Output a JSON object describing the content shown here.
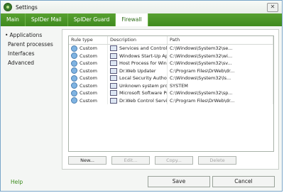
{
  "window": {
    "title": "Settings"
  },
  "tabs": [
    "Main",
    "SpIDer Mail",
    "SpIDer Guard",
    "Firewall"
  ],
  "active_tab": "Firewall",
  "sidebar": {
    "items": [
      "Applications",
      "Parent processes",
      "Interfaces",
      "Advanced"
    ],
    "active": "Applications"
  },
  "table": {
    "headers": [
      "Rule type",
      "Description",
      "Path"
    ],
    "rows": [
      {
        "rule_type": "Custom",
        "description": "Services and Controller ...",
        "path": "C:\\Windows\\System32\\se..."
      },
      {
        "rule_type": "Custom",
        "description": "Windows Start-Up Appli...",
        "path": "C:\\Windows\\System32\\wi..."
      },
      {
        "rule_type": "Custom",
        "description": "Host Process for Windo...",
        "path": "C:\\Windows\\System32\\sv..."
      },
      {
        "rule_type": "Custom",
        "description": "Dr.Web Updater",
        "path": "C:\\Program Files\\DrWeb\\dr..."
      },
      {
        "rule_type": "Custom",
        "description": "Local Security Authority ...",
        "path": "C:\\Windows\\System32\\ls..."
      },
      {
        "rule_type": "Custom",
        "description": "Unknown system process",
        "path": "SYSTEM"
      },
      {
        "rule_type": "Custom",
        "description": "Microsoft Software Prot...",
        "path": "C:\\Windows\\System32\\sp..."
      },
      {
        "rule_type": "Custom",
        "description": "Dr.Web Control Service",
        "path": "C:\\Program Files\\DrWeb\\dr..."
      }
    ]
  },
  "buttons": {
    "new": "New...",
    "edit": "Edit...",
    "copy": "Copy...",
    "delete": "Delete"
  },
  "footer": {
    "help": "Help",
    "save": "Save",
    "cancel": "Cancel"
  }
}
